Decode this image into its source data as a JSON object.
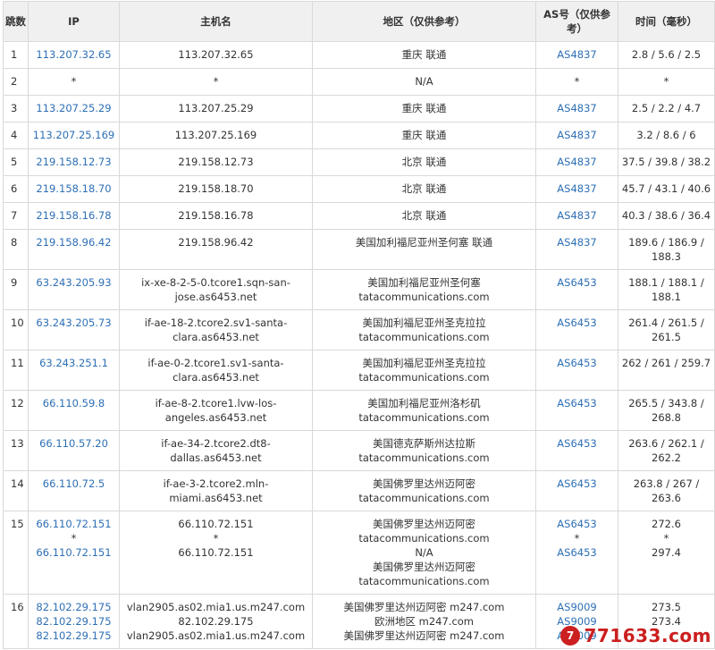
{
  "header": {
    "hop": "跳数",
    "ip": "IP",
    "hostname": "主机名",
    "region": "地区（仅供参考）",
    "asn": "AS号（仅供参考）",
    "time": "时间（毫秒）"
  },
  "rows": [
    {
      "hop": "1",
      "ip": [
        "113.207.32.65"
      ],
      "host": [
        "113.207.32.65"
      ],
      "region": [
        "重庆 联通"
      ],
      "asn": [
        "AS4837"
      ],
      "time": [
        "2.8 / 5.6 / 2.5"
      ]
    },
    {
      "hop": "2",
      "ip": [
        "*"
      ],
      "host": [
        "*"
      ],
      "region": [
        "N/A"
      ],
      "asn": [
        "*"
      ],
      "time": [
        "*"
      ]
    },
    {
      "hop": "3",
      "ip": [
        "113.207.25.29"
      ],
      "host": [
        "113.207.25.29"
      ],
      "region": [
        "重庆 联通"
      ],
      "asn": [
        "AS4837"
      ],
      "time": [
        "2.5 / 2.2 / 4.7"
      ]
    },
    {
      "hop": "4",
      "ip": [
        "113.207.25.169"
      ],
      "host": [
        "113.207.25.169"
      ],
      "region": [
        "重庆 联通"
      ],
      "asn": [
        "AS4837"
      ],
      "time": [
        "3.2 / 8.6 / 6"
      ]
    },
    {
      "hop": "5",
      "ip": [
        "219.158.12.73"
      ],
      "host": [
        "219.158.12.73"
      ],
      "region": [
        "北京 联通"
      ],
      "asn": [
        "AS4837"
      ],
      "time": [
        "37.5 / 39.8 / 38.2"
      ]
    },
    {
      "hop": "6",
      "ip": [
        "219.158.18.70"
      ],
      "host": [
        "219.158.18.70"
      ],
      "region": [
        "北京 联通"
      ],
      "asn": [
        "AS4837"
      ],
      "time": [
        "45.7 / 43.1 / 40.6"
      ]
    },
    {
      "hop": "7",
      "ip": [
        "219.158.16.78"
      ],
      "host": [
        "219.158.16.78"
      ],
      "region": [
        "北京 联通"
      ],
      "asn": [
        "AS4837"
      ],
      "time": [
        "40.3 / 38.6 / 36.4"
      ]
    },
    {
      "hop": "8",
      "ip": [
        "219.158.96.42"
      ],
      "host": [
        "219.158.96.42"
      ],
      "region": [
        "美国加利福尼亚州圣何塞 联通"
      ],
      "asn": [
        "AS4837"
      ],
      "time": [
        "189.6 / 186.9 / 188.3"
      ]
    },
    {
      "hop": "9",
      "ip": [
        "63.243.205.93"
      ],
      "host": [
        "ix-xe-8-2-5-0.tcore1.sqn-san-jose.as6453.net"
      ],
      "region": [
        "美国加利福尼亚州圣何塞",
        "tatacommunications.com"
      ],
      "asn": [
        "AS6453"
      ],
      "time": [
        "188.1 / 188.1 / 188.1"
      ]
    },
    {
      "hop": "10",
      "ip": [
        "63.243.205.73"
      ],
      "host": [
        "if-ae-18-2.tcore2.sv1-santa-clara.as6453.net"
      ],
      "region": [
        "美国加利福尼亚州圣克拉拉",
        "tatacommunications.com"
      ],
      "asn": [
        "AS6453"
      ],
      "time": [
        "261.4 / 261.5 / 261.5"
      ]
    },
    {
      "hop": "11",
      "ip": [
        "63.243.251.1"
      ],
      "host": [
        "if-ae-0-2.tcore1.sv1-santa-clara.as6453.net"
      ],
      "region": [
        "美国加利福尼亚州圣克拉拉",
        "tatacommunications.com"
      ],
      "asn": [
        "AS6453"
      ],
      "time": [
        "262 / 261 / 259.7"
      ]
    },
    {
      "hop": "12",
      "ip": [
        "66.110.59.8"
      ],
      "host": [
        "if-ae-8-2.tcore1.lvw-los-angeles.as6453.net"
      ],
      "region": [
        "美国加利福尼亚州洛杉矶",
        "tatacommunications.com"
      ],
      "asn": [
        "AS6453"
      ],
      "time": [
        "265.5 / 343.8 / 268.8"
      ]
    },
    {
      "hop": "13",
      "ip": [
        "66.110.57.20"
      ],
      "host": [
        "if-ae-34-2.tcore2.dt8-dallas.as6453.net"
      ],
      "region": [
        "美国德克萨斯州达拉斯",
        "tatacommunications.com"
      ],
      "asn": [
        "AS6453"
      ],
      "time": [
        "263.6 / 262.1 / 262.2"
      ]
    },
    {
      "hop": "14",
      "ip": [
        "66.110.72.5"
      ],
      "host": [
        "if-ae-3-2.tcore2.mln-miami.as6453.net"
      ],
      "region": [
        "美国佛罗里达州迈阿密",
        "tatacommunications.com"
      ],
      "asn": [
        "AS6453"
      ],
      "time": [
        "263.8 / 267 / 263.6"
      ]
    },
    {
      "hop": "15",
      "ip": [
        "66.110.72.151",
        "*",
        "66.110.72.151"
      ],
      "host": [
        "66.110.72.151",
        "*",
        "66.110.72.151"
      ],
      "region": [
        "美国佛罗里达州迈阿密",
        "tatacommunications.com",
        "N/A",
        "美国佛罗里达州迈阿密",
        "tatacommunications.com"
      ],
      "asn": [
        "AS6453",
        "*",
        "AS6453"
      ],
      "time": [
        "272.6",
        "*",
        "297.4"
      ]
    },
    {
      "hop": "16",
      "ip": [
        "82.102.29.175",
        "82.102.29.175",
        "82.102.29.175"
      ],
      "host": [
        "vlan2905.as02.mia1.us.m247.com",
        "82.102.29.175",
        "vlan2905.as02.mia1.us.m247.com"
      ],
      "region": [
        "美国佛罗里达州迈阿密 m247.com",
        "欧洲地区 m247.com",
        "美国佛罗里达州迈阿密 m247.com"
      ],
      "asn": [
        "AS9009",
        "AS9009",
        "AS9009"
      ],
      "time": [
        "273.5",
        "273.4",
        ""
      ]
    }
  ],
  "watermark": {
    "logo": "7",
    "text": "771633.com"
  },
  "colors": {
    "link": "#2d6fb5",
    "header_bg": "#f0f0f0",
    "border": "#d9d9d9",
    "watermark": "#cc1f1f"
  }
}
